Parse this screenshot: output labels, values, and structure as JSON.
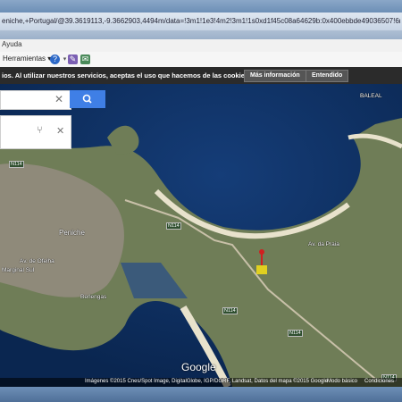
{
  "browser": {
    "url": "eniche,+Portugal/@39.3619113,-9.3662903,4494m/data=!3m1!1e3!4m2!3m1!1s0xd1f45c08a64629b:0x400ebbde49036507!6m1!1e1?hl=es",
    "menu_item": "Ayuda",
    "toolbar_label": "Herramientas",
    "toolbar_dropdown_icon": "caret-down-icon",
    "help_icon": "help-icon",
    "icon2": "toolbar-icon",
    "icon3": "toolbar-icon"
  },
  "cookie_banner": {
    "text": "ios. Al utilizar nuestros servicios, aceptas el uso que hacemos de las cookies.",
    "more_info": "Más información",
    "accept": "Entendido"
  },
  "map": {
    "search_clear_icon": "close-icon",
    "search_button_icon": "search-icon",
    "directions_icon": "directions-icon",
    "directions_close_icon": "close-icon",
    "labels": {
      "peniche": "Peniche",
      "baleal": "BALEAL",
      "berlengas": "Berlengas",
      "marginal": "Marginal Sul",
      "praia": "Av. da Praia",
      "av_aviacao": "Av. de Ofelha",
      "n114_1": "N114",
      "n114_2": "N114",
      "n114_3": "N114",
      "n114_4": "N114",
      "n114_5": "N114"
    },
    "logo": "Google",
    "footer": {
      "imagery": "Imágenes ©2015 Cnes/Spot Image, DigitalGlobe, IGP/DGRF, Landsat, Datos del mapa ©2015 Google",
      "mode": "Modo básico",
      "terms": "Condiciones"
    }
  }
}
